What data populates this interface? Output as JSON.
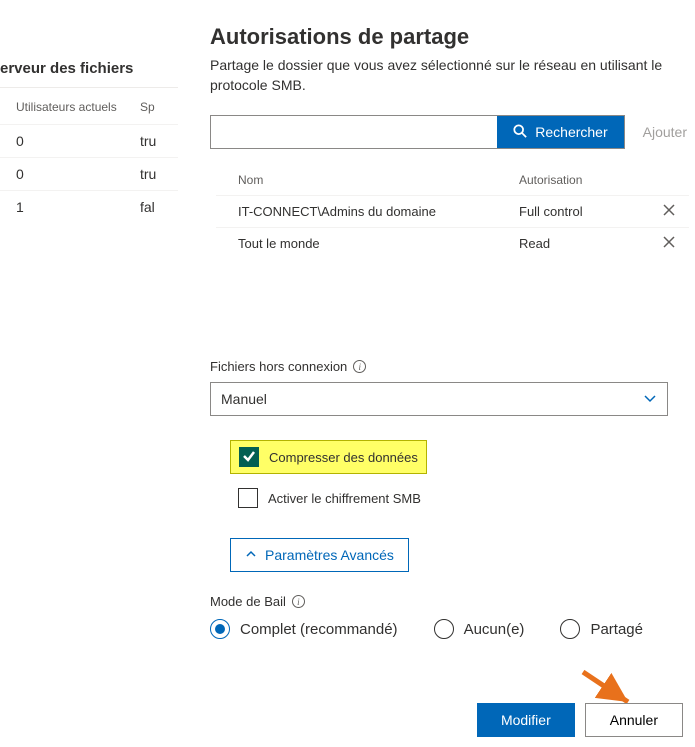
{
  "left": {
    "title": "erveur des fichiers",
    "headers": {
      "c1": "Utilisateurs actuels",
      "c2": "Sp"
    },
    "rows": [
      {
        "c1": "0",
        "c2": "tru"
      },
      {
        "c1": "0",
        "c2": "tru"
      },
      {
        "c1": "1",
        "c2": "fal"
      }
    ]
  },
  "panel": {
    "title": "Autorisations de partage",
    "subtitle": "Partage le dossier que vous avez sélectionné sur le réseau en utilisant le protocole SMB.",
    "search_placeholder": "",
    "search_btn": "Rechercher",
    "add_btn": "Ajouter",
    "perm_headers": {
      "name": "Nom",
      "auth": "Autorisation"
    },
    "perms": [
      {
        "name": "IT-CONNECT\\Admins du domaine",
        "auth": "Full control"
      },
      {
        "name": "Tout le monde",
        "auth": "Read"
      }
    ],
    "offline_label": "Fichiers hors connexion",
    "offline_value": "Manuel",
    "compress_label": "Compresser des données",
    "encrypt_label": "Activer le chiffrement SMB",
    "advanced": "Paramètres Avancés",
    "lease_label": "Mode de Bail",
    "lease_options": {
      "full": "Complet (recommandé)",
      "none": "Aucun(e)",
      "shared": "Partagé"
    },
    "modify": "Modifier",
    "cancel": "Annuler"
  }
}
